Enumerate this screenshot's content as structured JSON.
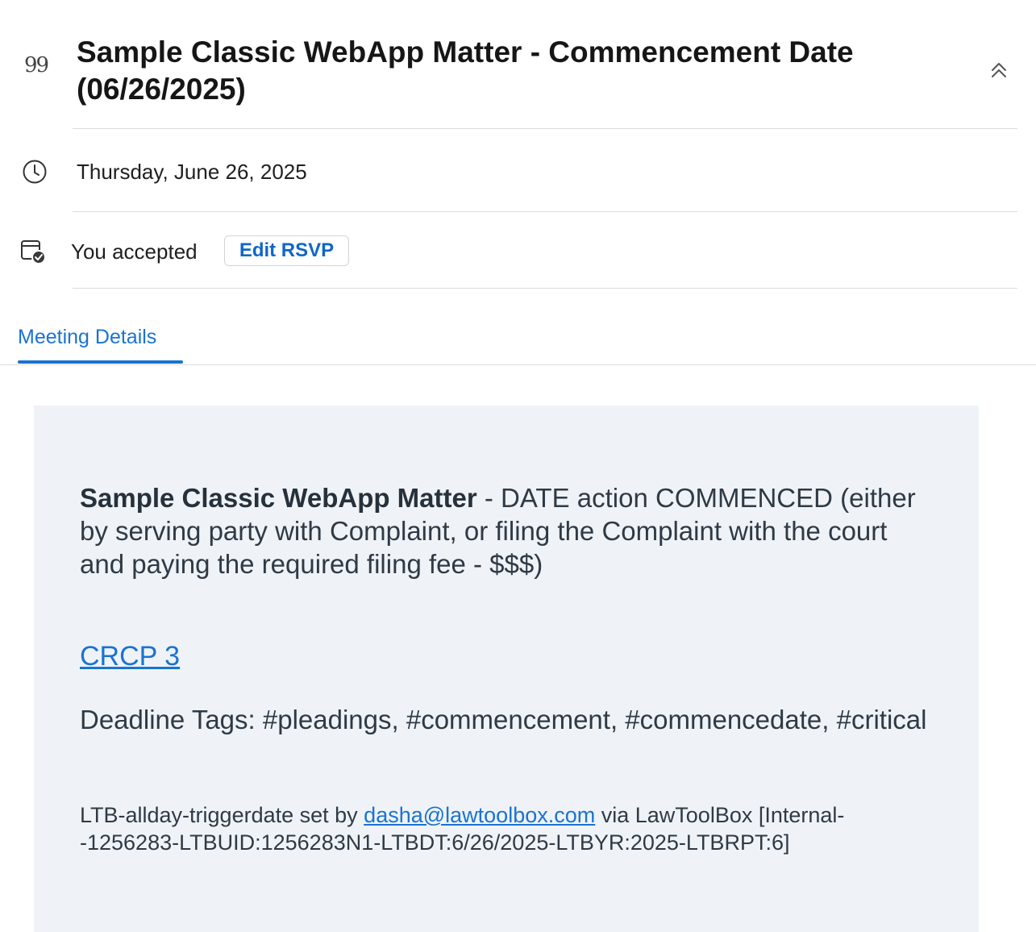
{
  "event": {
    "title": "Sample Classic WebApp Matter - Commencement Date (06/26/2025)",
    "date": "Thursday, June 26, 2025",
    "rsvp_status": "You accepted",
    "edit_rsvp_label": "Edit RSVP"
  },
  "header_icons": {
    "subject": "quote-icon",
    "collapse": "chevron-double-up-icon",
    "date": "clock-icon",
    "rsvp": "calendar-check-icon"
  },
  "tabs": [
    {
      "label": "Meeting Details",
      "selected": true
    }
  ],
  "body": {
    "matter_name": "Sample Classic WebApp Matter",
    "description": " - DATE action COMMENCED (either by serving party with Complaint, or filing the Complaint with the court and paying the required filing fee - $$$)",
    "rule_link": "CRCP 3",
    "tags_text": "Deadline Tags: #pleadings, #commencement, #commencedate, #critical",
    "footer_prefix": "LTB-allday-triggerdate set by ",
    "footer_email": "dasha@lawtoolbox.com",
    "footer_suffix": " via LawToolBox [Internal--1256283-LTBUID:1256283N1-LTBDT:6/26/2025-LTBYR:2025-LTBRPT:6]"
  },
  "colors": {
    "accent": "#1a73d1",
    "panel_background": "#eff3f7",
    "divider": "#dcdcdc"
  }
}
